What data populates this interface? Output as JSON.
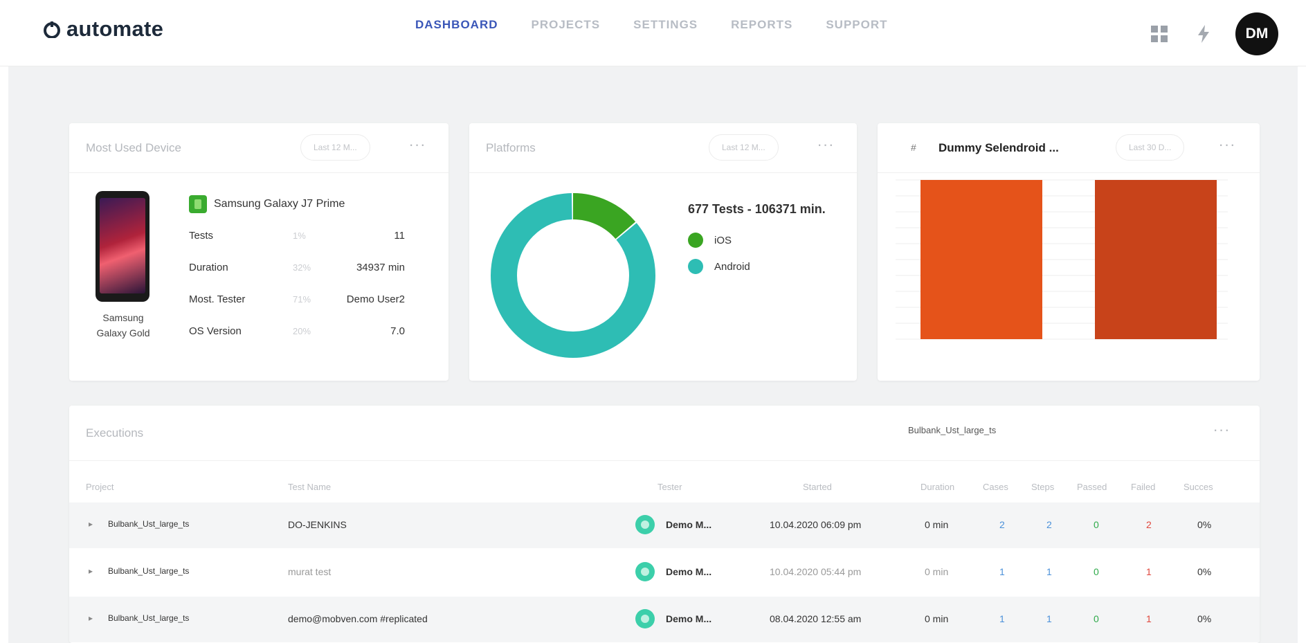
{
  "app": {
    "logo_text": "automate",
    "nav": [
      {
        "label": "DASHBOARD",
        "active": true
      },
      {
        "label": "PROJECTS",
        "active": false
      },
      {
        "label": "SETTINGS",
        "active": false
      },
      {
        "label": "REPORTS",
        "active": false
      },
      {
        "label": "SUPPORT",
        "active": false
      }
    ],
    "icons": [
      "grid-icon",
      "lightning-icon"
    ],
    "user_initials": "DM",
    "accent": "#3a56b8"
  },
  "device_card": {
    "title": "Most Used Device",
    "filter": "Last 12 M...",
    "device_name_line1": "Samsung",
    "device_name_line2": "Galaxy Gold",
    "model": "Samsung Galaxy J7 Prime",
    "stats": [
      {
        "label": "Tests",
        "pct": "1%",
        "value": "11"
      },
      {
        "label": "Duration",
        "pct": "32%",
        "value": "34937 min"
      },
      {
        "label": "Most. Tester",
        "pct": "71%",
        "value": "Demo User2"
      },
      {
        "label": "OS Version",
        "pct": "20%",
        "value": "7.0"
      }
    ]
  },
  "platforms_card": {
    "title": "Platforms",
    "filter": "Last 12 M...",
    "summary": "677 Tests - 106371 min.",
    "legend": [
      {
        "label": "iOS",
        "color": "#3aa522",
        "share": 0.14
      },
      {
        "label": "Android",
        "color": "#2ebdb4",
        "share": 0.86
      }
    ]
  },
  "bar_card": {
    "title": "Dummy Selendroid ...",
    "filter": "Last 30 D...",
    "bars": [
      {
        "value": 100,
        "color": "#e5531a"
      },
      {
        "value": 100,
        "color": "#c8431a"
      }
    ]
  },
  "executions": {
    "title": "Executions",
    "project_filter": "Bulbank_Ust_large_ts",
    "columns": [
      "Project",
      "Test Name",
      "Tester",
      "Started",
      "Duration",
      "Cases",
      "Steps",
      "Passed",
      "Failed",
      "Succes"
    ],
    "rows": [
      {
        "project": "Bulbank_Ust_large_ts",
        "test": "DO-JENKINS",
        "tester": "Demo M...",
        "started": "10.04.2020 06:09 pm",
        "duration": "0 min",
        "cases": "2",
        "steps": "2",
        "passed": "0",
        "failed": "2",
        "success": "0%"
      },
      {
        "project": "Bulbank_Ust_large_ts",
        "test": "murat test",
        "tester": "Demo M...",
        "started": "10.04.2020 05:44 pm",
        "duration": "0 min",
        "cases": "1",
        "steps": "1",
        "passed": "0",
        "failed": "1",
        "success": "0%"
      },
      {
        "project": "Bulbank_Ust_large_ts",
        "test": "demo@mobven.com #replicated",
        "tester": "Demo M...",
        "started": "08.04.2020 12:55 am",
        "duration": "0 min",
        "cases": "1",
        "steps": "1",
        "passed": "0",
        "failed": "1",
        "success": "0%"
      }
    ]
  }
}
